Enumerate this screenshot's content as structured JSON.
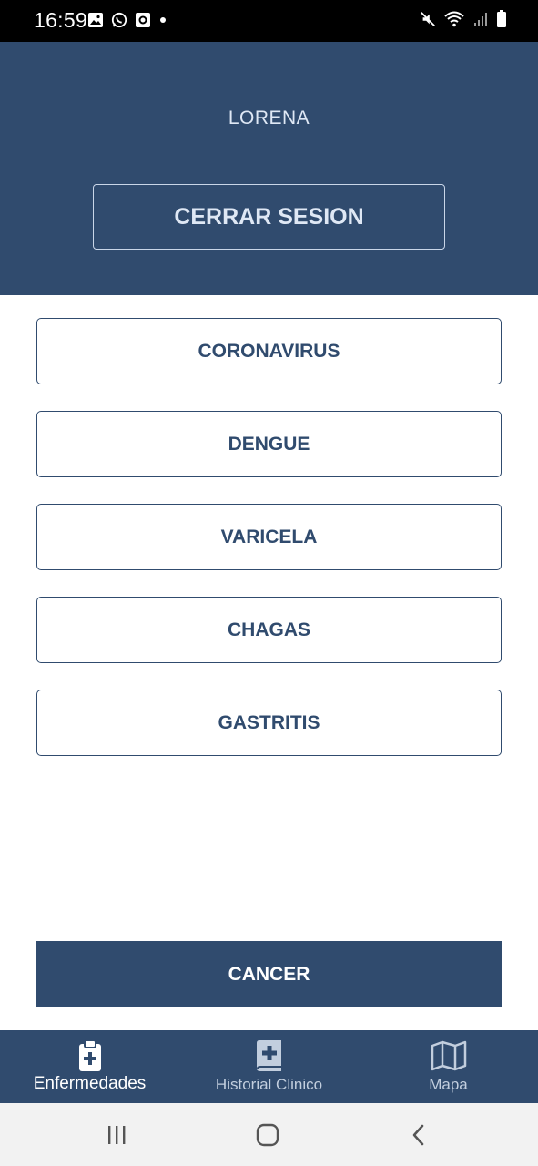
{
  "status_bar": {
    "time": "16:59",
    "left_icons": [
      "image-icon",
      "whatsapp-icon",
      "notification-app-icon",
      "dot-icon"
    ],
    "right_icons": [
      "mute-icon",
      "wifi-icon",
      "signal-icon",
      "battery-icon"
    ]
  },
  "header": {
    "user_name": "LORENA",
    "logout_label": "CERRAR SESION"
  },
  "diseases": [
    {
      "label": "CORONAVIRUS"
    },
    {
      "label": "DENGUE"
    },
    {
      "label": "VARICELA"
    },
    {
      "label": "CHAGAS"
    },
    {
      "label": "GASTRITIS"
    }
  ],
  "cancer_label": "CANCER",
  "bottom_nav": {
    "items": [
      {
        "label": "Enfermedades",
        "icon": "clipboard-plus-icon",
        "active": true
      },
      {
        "label": "Historial Clinico",
        "icon": "medical-book-icon",
        "active": false
      },
      {
        "label": "Mapa",
        "icon": "map-icon",
        "active": false
      }
    ]
  },
  "system_nav": [
    "recent-apps-icon",
    "home-icon",
    "back-icon"
  ],
  "colors": {
    "primary": "#304b6e",
    "header_text": "#dfe8f5",
    "background": "#ffffff"
  }
}
